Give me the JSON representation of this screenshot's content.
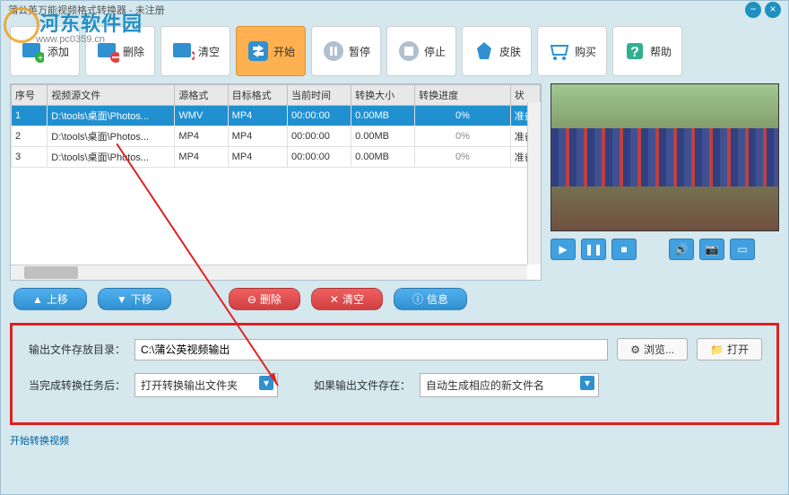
{
  "title": "蒲公英万能视频格式转换器 - 未注册",
  "watermark": "河东软件园",
  "watermark_sub": "www.pc0359.cn",
  "toolbar": {
    "add": "添加",
    "delete": "删除",
    "clear": "清空",
    "start": "开始",
    "pause": "暂停",
    "stop": "停止",
    "skin": "皮肤",
    "buy": "购买",
    "help": "帮助"
  },
  "table": {
    "headers": [
      "序号",
      "视频源文件",
      "源格式",
      "目标格式",
      "当前时间",
      "转换大小",
      "转换进度",
      "状"
    ],
    "rows": [
      {
        "idx": "1",
        "src": "D:\\tools\\桌面\\Photos...",
        "sfmt": "WMV",
        "tfmt": "MP4",
        "time": "00:00:00",
        "size": "0.00MB",
        "prog": "0%",
        "st": "准备"
      },
      {
        "idx": "2",
        "src": "D:\\tools\\桌面\\Photos...",
        "sfmt": "MP4",
        "tfmt": "MP4",
        "time": "00:00:00",
        "size": "0.00MB",
        "prog": "0%",
        "st": "准备"
      },
      {
        "idx": "3",
        "src": "D:\\tools\\桌面\\Photos...",
        "sfmt": "MP4",
        "tfmt": "MP4",
        "time": "00:00:00",
        "size": "0.00MB",
        "prog": "0%",
        "st": "准备"
      }
    ]
  },
  "listops": {
    "up": "上移",
    "down": "下移",
    "del": "删除",
    "clear": "清空",
    "info": "信息"
  },
  "output": {
    "dir_label": "输出文件存放目录：",
    "dir_value": "C:\\蒲公英视频输出",
    "browse": "浏览...",
    "open": "打开",
    "after_label": "当完成转换任务后：",
    "after_value": "打开转换输出文件夹",
    "exists_label": "如果输出文件存在：",
    "exists_value": "自动生成相应的新文件名"
  },
  "status": "开始转换视频"
}
